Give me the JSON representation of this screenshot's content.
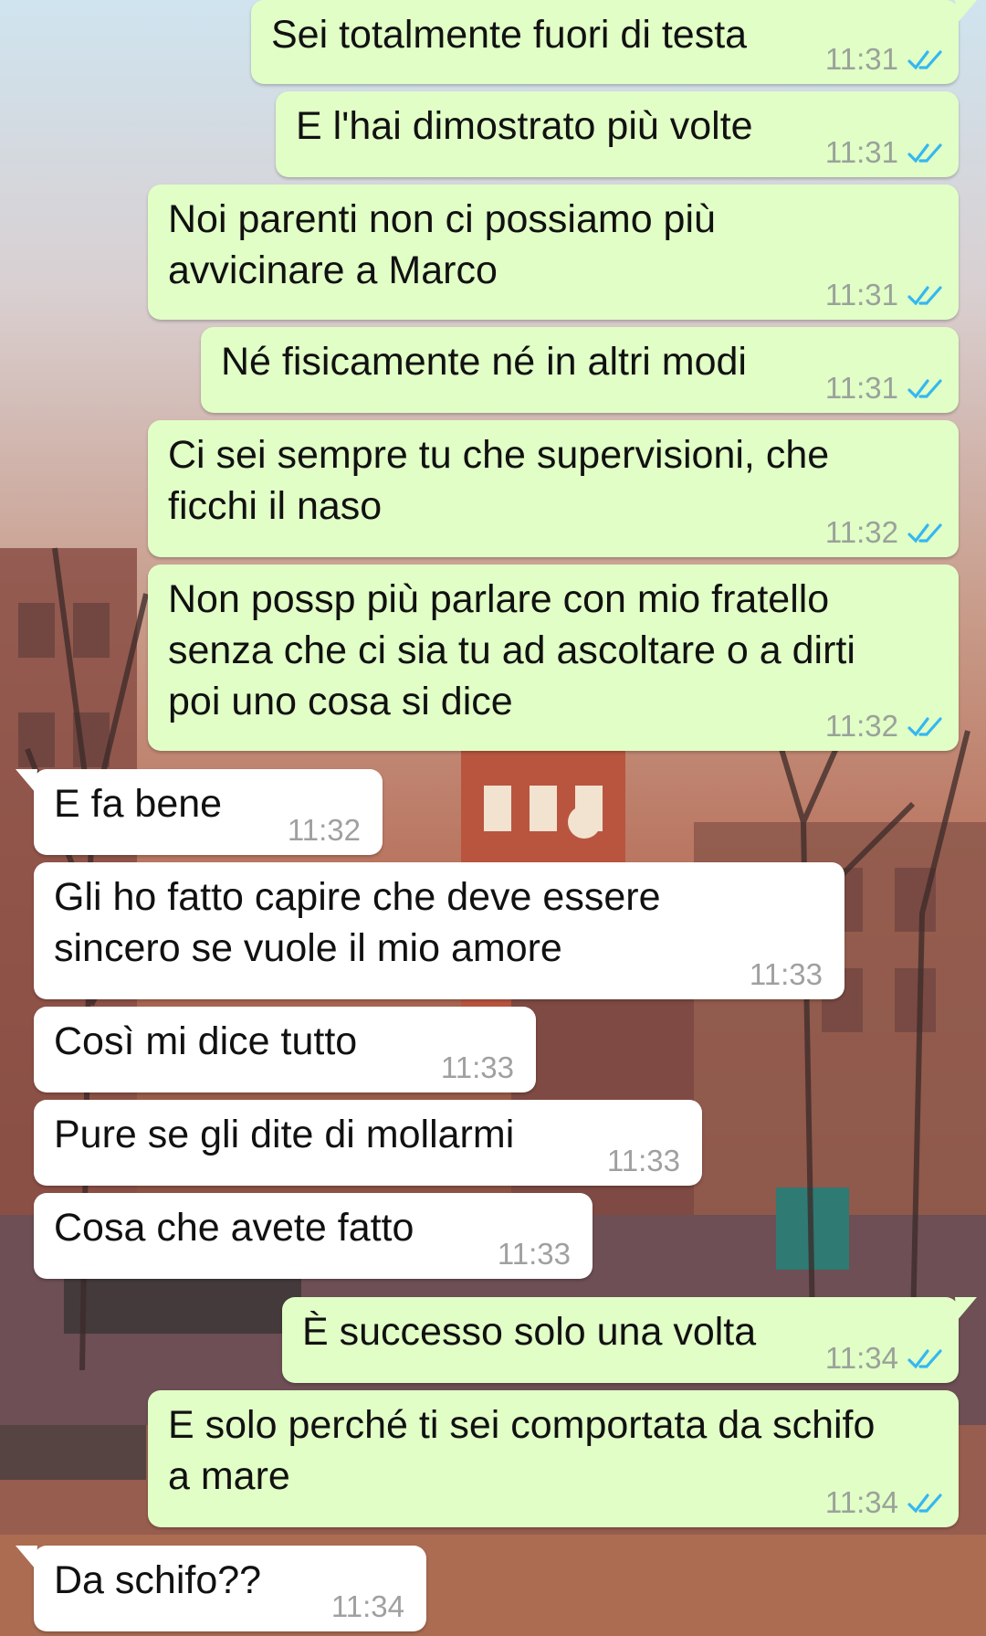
{
  "colors": {
    "outgoing_bubble": "#e1fec6",
    "incoming_bubble": "#ffffff",
    "read_ticks": "#34b7f1",
    "timestamp": "#9aa29a"
  },
  "icons": {
    "read_status": "double-check-icon"
  },
  "messages": [
    {
      "direction": "outgoing",
      "text": "Sei totalmente fuori di testa",
      "time": "11:31",
      "status": "read"
    },
    {
      "direction": "outgoing",
      "text": "E l'hai dimostrato più volte",
      "time": "11:31",
      "status": "read"
    },
    {
      "direction": "outgoing",
      "text": "Noi parenti non ci possiamo più\navvicinare a Marco",
      "time": "11:31",
      "status": "read"
    },
    {
      "direction": "outgoing",
      "text": "Né fisicamente né in altri modi",
      "time": "11:31",
      "status": "read"
    },
    {
      "direction": "outgoing",
      "text": "Ci sei sempre tu che supervisioni, che\nficchi il naso",
      "time": "11:32",
      "status": "read"
    },
    {
      "direction": "outgoing",
      "text": "Non possp più parlare con mio fratello\nsenza che ci sia tu ad ascoltare o a dirti\npoi uno cosa si dice",
      "time": "11:32",
      "status": "read"
    },
    {
      "direction": "incoming",
      "text": "E fa bene",
      "time": "11:32"
    },
    {
      "direction": "incoming",
      "text": "Gli ho fatto capire che deve essere\nsincero se vuole il mio amore",
      "time": "11:33"
    },
    {
      "direction": "incoming",
      "text": "Così mi dice tutto",
      "time": "11:33"
    },
    {
      "direction": "incoming",
      "text": "Pure se gli dite di mollarmi",
      "time": "11:33"
    },
    {
      "direction": "incoming",
      "text": "Cosa che avete fatto",
      "time": "11:33"
    },
    {
      "direction": "outgoing",
      "text": "È successo solo una volta",
      "time": "11:34",
      "status": "read"
    },
    {
      "direction": "outgoing",
      "text": "E solo perché ti sei comportata da schifo\na mare",
      "time": "11:34",
      "status": "read"
    },
    {
      "direction": "incoming",
      "text": "Da schifo??",
      "time": "11:34"
    }
  ]
}
